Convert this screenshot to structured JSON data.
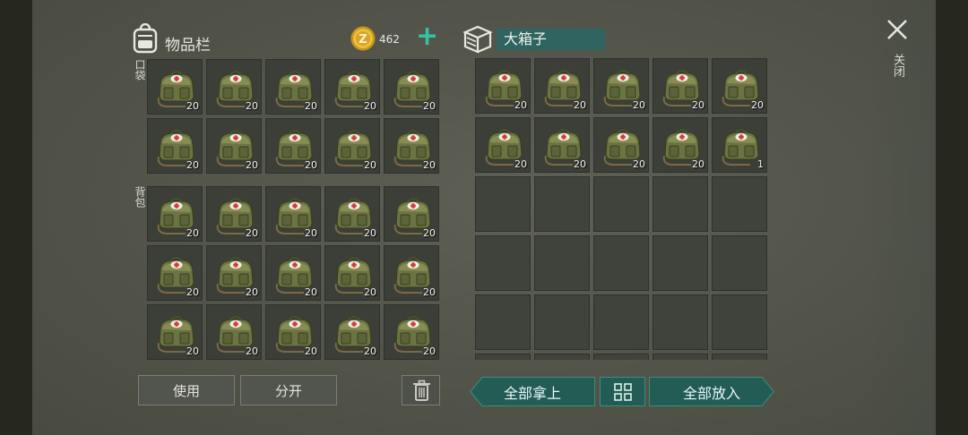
{
  "inventory": {
    "title": "物品栏",
    "coin_count": "462",
    "plus": "+",
    "pocket_label": "口袋",
    "backpack_label": "背包",
    "pocket_slots": [
      {
        "item": "military-medkit-bag",
        "qty": "20"
      },
      {
        "item": "military-medkit-bag",
        "qty": "20"
      },
      {
        "item": "military-medkit-bag",
        "qty": "20"
      },
      {
        "item": "military-medkit-bag",
        "qty": "20"
      },
      {
        "item": "military-medkit-bag",
        "qty": "20"
      },
      {
        "item": "military-medkit-bag",
        "qty": "20"
      },
      {
        "item": "military-medkit-bag",
        "qty": "20"
      },
      {
        "item": "military-medkit-bag",
        "qty": "20"
      },
      {
        "item": "military-medkit-bag",
        "qty": "20"
      },
      {
        "item": "military-medkit-bag",
        "qty": "20"
      }
    ],
    "backpack_slots": [
      {
        "item": "military-medkit-bag",
        "qty": "20"
      },
      {
        "item": "military-medkit-bag",
        "qty": "20"
      },
      {
        "item": "military-medkit-bag",
        "qty": "20"
      },
      {
        "item": "military-medkit-bag",
        "qty": "20"
      },
      {
        "item": "military-medkit-bag",
        "qty": "20"
      },
      {
        "item": "military-medkit-bag",
        "qty": "20"
      },
      {
        "item": "military-medkit-bag",
        "qty": "20"
      },
      {
        "item": "military-medkit-bag",
        "qty": "20"
      },
      {
        "item": "military-medkit-bag",
        "qty": "20"
      },
      {
        "item": "military-medkit-bag",
        "qty": "20"
      },
      {
        "item": "military-medkit-bag",
        "qty": "20"
      },
      {
        "item": "military-medkit-bag",
        "qty": "20"
      },
      {
        "item": "military-medkit-bag",
        "qty": "20"
      },
      {
        "item": "military-medkit-bag",
        "qty": "20"
      },
      {
        "item": "military-medkit-bag",
        "qty": "20"
      }
    ],
    "use_label": "使用",
    "split_label": "分开",
    "trash_icon": "trash-icon"
  },
  "box": {
    "title": "大箱子",
    "slots": [
      {
        "item": "military-medkit-bag",
        "qty": "20"
      },
      {
        "item": "military-medkit-bag",
        "qty": "20"
      },
      {
        "item": "military-medkit-bag",
        "qty": "20"
      },
      {
        "item": "military-medkit-bag",
        "qty": "20"
      },
      {
        "item": "military-medkit-bag",
        "qty": "20"
      },
      {
        "item": "military-medkit-bag",
        "qty": "20"
      },
      {
        "item": "military-medkit-bag",
        "qty": "20"
      },
      {
        "item": "military-medkit-bag",
        "qty": "20"
      },
      {
        "item": "military-medkit-bag",
        "qty": "20"
      },
      {
        "item": "military-medkit-bag",
        "qty": "1"
      },
      {},
      {},
      {},
      {},
      {},
      {},
      {},
      {},
      {},
      {},
      {},
      {},
      {},
      {},
      {},
      {},
      {},
      {},
      {},
      {}
    ],
    "take_all_label": "全部拿上",
    "put_all_label": "全部放入",
    "sort_icon": "grid-sort-icon"
  },
  "close": {
    "label": "关闭",
    "icon": "close-icon"
  },
  "colors": {
    "accent": "#36c2a6",
    "teal_button": "#225c54",
    "box_title_bg": "#2f6460",
    "coin": "#e0b12a"
  }
}
